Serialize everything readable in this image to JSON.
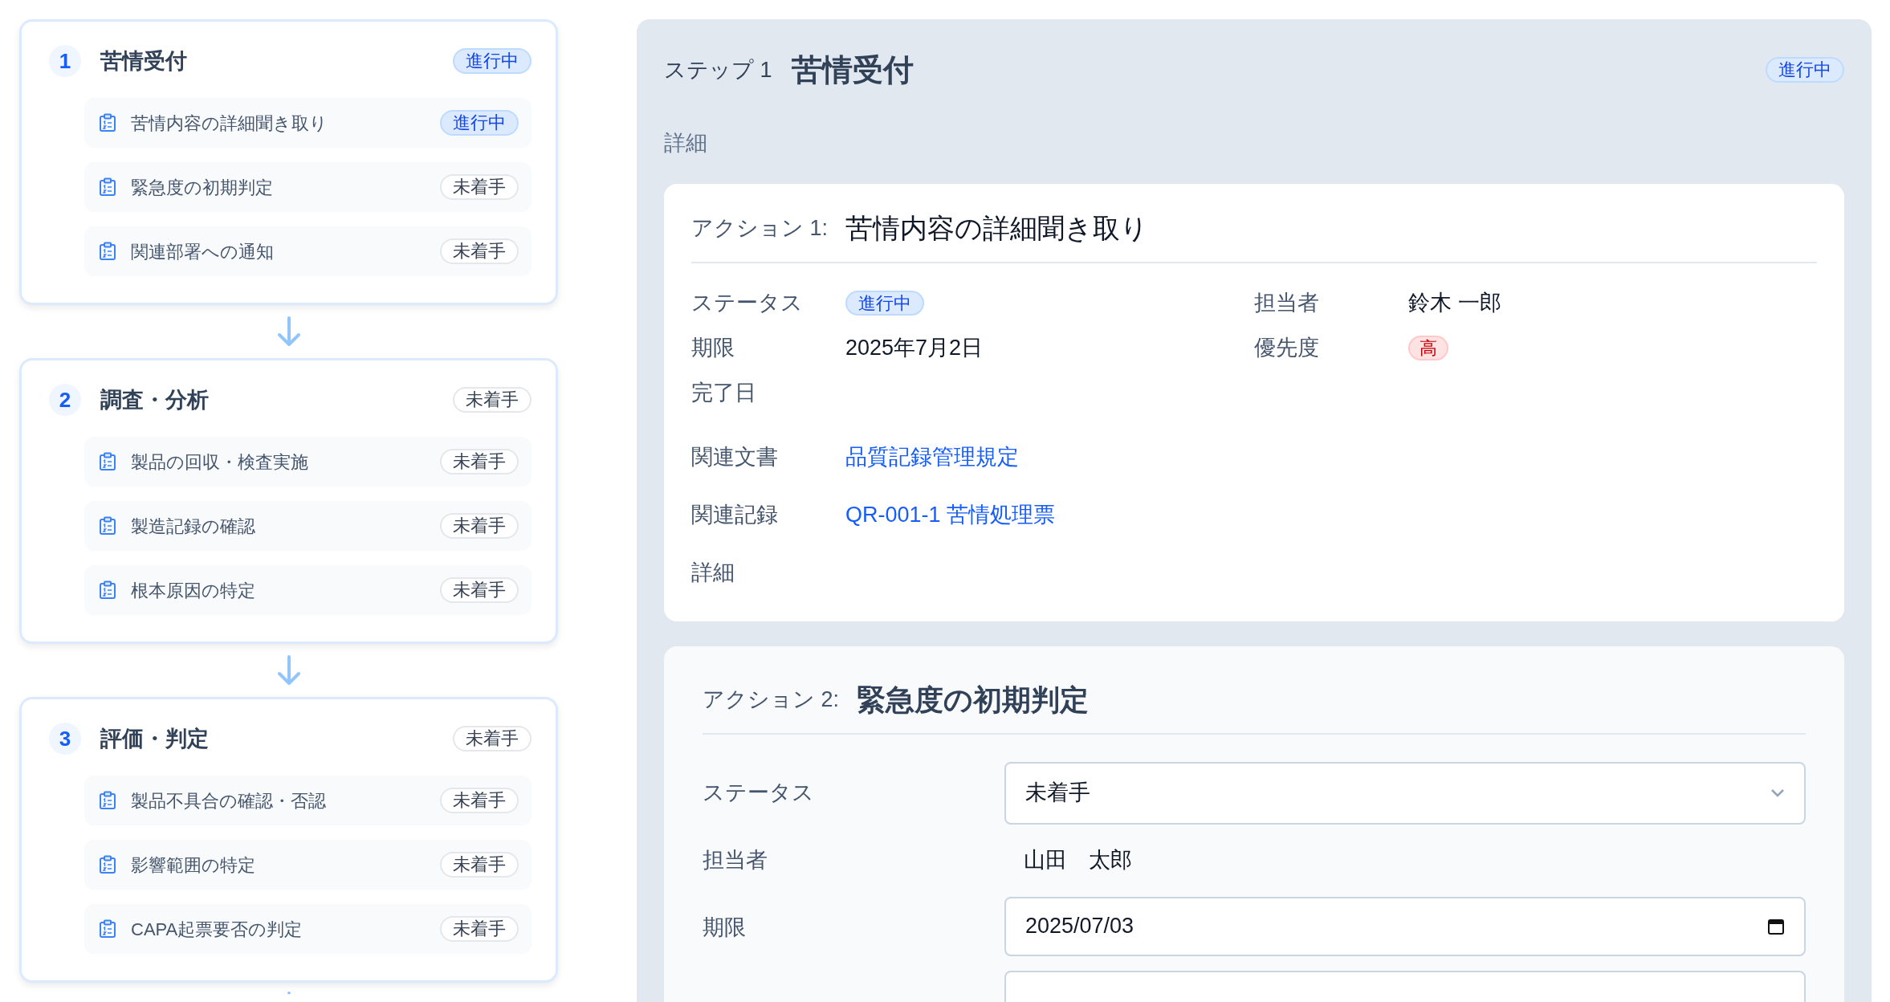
{
  "steps": [
    {
      "number": "1",
      "title": "苦情受付",
      "status": {
        "label": "進行中",
        "active": true
      },
      "actions": [
        {
          "title": "苦情内容の詳細聞き取り",
          "status": {
            "label": "進行中",
            "active": true
          }
        },
        {
          "title": "緊急度の初期判定",
          "status": {
            "label": "未着手",
            "active": false
          }
        },
        {
          "title": "関連部署への通知",
          "status": {
            "label": "未着手",
            "active": false
          }
        }
      ]
    },
    {
      "number": "2",
      "title": "調査・分析",
      "status": {
        "label": "未着手",
        "active": false
      },
      "actions": [
        {
          "title": "製品の回収・検査実施",
          "status": {
            "label": "未着手",
            "active": false
          }
        },
        {
          "title": "製造記録の確認",
          "status": {
            "label": "未着手",
            "active": false
          }
        },
        {
          "title": "根本原因の特定",
          "status": {
            "label": "未着手",
            "active": false
          }
        }
      ]
    },
    {
      "number": "3",
      "title": "評価・判定",
      "status": {
        "label": "未着手",
        "active": false
      },
      "actions": [
        {
          "title": "製品不具合の確認・否認",
          "status": {
            "label": "未着手",
            "active": false
          }
        },
        {
          "title": "影響範囲の特定",
          "status": {
            "label": "未着手",
            "active": false
          }
        },
        {
          "title": "CAPA起票要否の判定",
          "status": {
            "label": "未着手",
            "active": false
          }
        }
      ]
    }
  ],
  "detail": {
    "step_label": "ステップ 1",
    "title": "苦情受付",
    "status": {
      "label": "進行中",
      "active": true
    },
    "section_label": "詳細",
    "action_1": {
      "prefix": "アクション 1:",
      "title": "苦情内容の詳細聞き取り",
      "summary": [
        {
          "label": "ステータス",
          "kind": "status",
          "value": "進行中",
          "active": true
        },
        {
          "label": "担当者",
          "kind": "text",
          "value": "鈴木 一郎"
        },
        {
          "label": "期限",
          "kind": "text",
          "value": "2025年7月2日"
        },
        {
          "label": "優先度",
          "kind": "priority",
          "value": "高"
        },
        {
          "label": "完了日",
          "kind": "empty"
        }
      ],
      "more": [
        {
          "label": "関連文書",
          "kind": "link",
          "value": "品質記録管理規定"
        },
        {
          "label": "関連記録",
          "kind": "link",
          "value": "QR-001-1 苦情処理票"
        },
        {
          "label": "詳細",
          "kind": "empty"
        }
      ]
    },
    "action_2": {
      "prefix": "アクション 2:",
      "title": "緊急度の初期判定",
      "form": [
        {
          "label": "ステータス",
          "kind": "select",
          "value": "未着手"
        },
        {
          "label": "担当者",
          "kind": "text",
          "value": "山田　太郎"
        },
        {
          "label": "期限",
          "kind": "date",
          "value": "2025/07/03"
        },
        {
          "kind": "input"
        }
      ]
    }
  }
}
